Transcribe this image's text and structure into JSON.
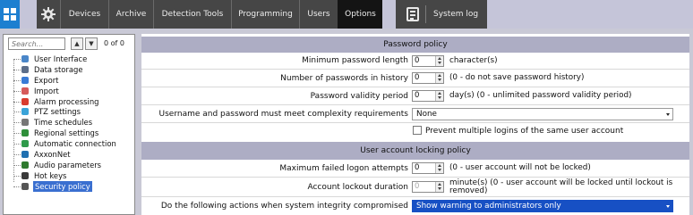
{
  "topbar": {
    "tabs": [
      {
        "label": "Devices"
      },
      {
        "label": "Archive"
      },
      {
        "label": "Detection Tools"
      },
      {
        "label": "Programming"
      },
      {
        "label": "Users"
      },
      {
        "label": "Options",
        "active": true
      }
    ],
    "system_log_label": "System log",
    "icons": {
      "app": "grid-icon",
      "settings": "gear-icon",
      "log": "system-log-icon"
    }
  },
  "sidebar": {
    "search_placeholder": "Search...",
    "match_count": "0 of 0",
    "items": [
      {
        "label": "User Interface",
        "icon": "monitor-icon",
        "color": "#4a86c8"
      },
      {
        "label": "Data storage",
        "icon": "storage-icon",
        "color": "#5c6e8a"
      },
      {
        "label": "Export",
        "icon": "export-icon",
        "color": "#3a7bd5"
      },
      {
        "label": "Import",
        "icon": "import-icon",
        "color": "#d65a5a"
      },
      {
        "label": "Alarm processing",
        "icon": "alarm-icon",
        "color": "#d83b2e"
      },
      {
        "label": "PTZ settings",
        "icon": "ptz-icon",
        "color": "#3aa3d8"
      },
      {
        "label": "Time schedules",
        "icon": "clock-icon",
        "color": "#777777"
      },
      {
        "label": "Regional settings",
        "icon": "globe-icon",
        "color": "#2f8f3a"
      },
      {
        "label": "Automatic connection",
        "icon": "connection-icon",
        "color": "#2f9a4a"
      },
      {
        "label": "AxxonNet",
        "icon": "axxonnet-icon",
        "color": "#1f6fb0"
      },
      {
        "label": "Audio parameters",
        "icon": "audio-icon",
        "color": "#2e7a2e"
      },
      {
        "label": "Hot keys",
        "icon": "hotkeys-icon",
        "color": "#3a3a3a"
      },
      {
        "label": "Security policy",
        "icon": "security-icon",
        "color": "#555555",
        "selected": true
      }
    ]
  },
  "password_policy": {
    "header": "Password policy",
    "min_length": {
      "label": "Minimum password length",
      "value": "0",
      "unit": "character(s)"
    },
    "history": {
      "label": "Number of passwords in history",
      "value": "0",
      "unit": "(0 - do not save password history)"
    },
    "validity": {
      "label": "Password validity period",
      "value": "0",
      "unit": "day(s) (0 - unlimited password validity period)"
    },
    "complexity": {
      "label": "Username and password must meet complexity requirements",
      "value": "None"
    },
    "multiple_logins": {
      "label": "Prevent multiple logins of the same user account",
      "checked": false
    }
  },
  "lockout_policy": {
    "header": "User account locking policy",
    "max_failed": {
      "label": "Maximum failed logon attempts",
      "value": "0",
      "unit": "(0 - user account will not be locked)"
    },
    "duration": {
      "label": "Account lockout duration",
      "value": "0",
      "unit": "minute(s) (0 - user account will be locked until lockout is removed)"
    },
    "integrity": {
      "label": "Do the following actions when system integrity compromised",
      "value": "Show warning to administrators only"
    }
  }
}
